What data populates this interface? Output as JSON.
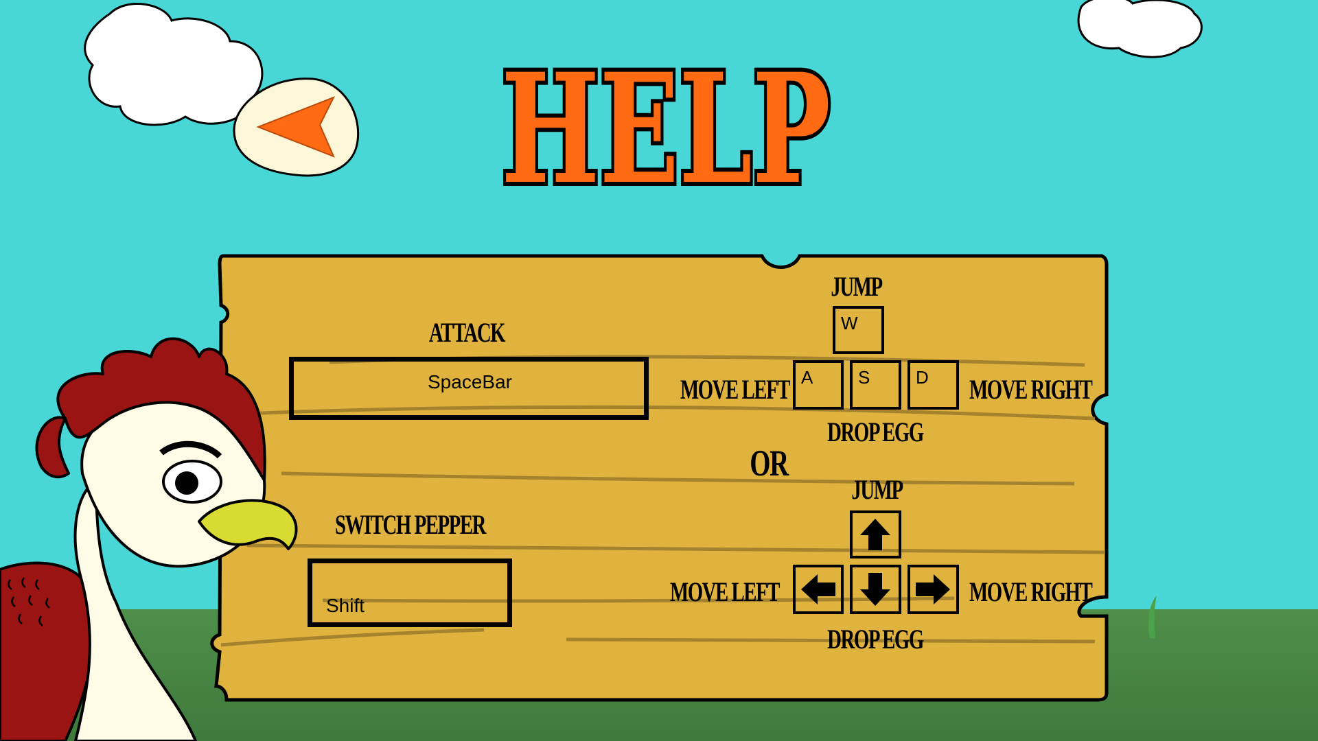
{
  "screen": {
    "title": "HELP",
    "back_icon": "left-arrow-egg-icon"
  },
  "controls": {
    "attack_label": "ATTACK",
    "attack_key": "SpaceBar",
    "switch_label": "SWITCH PEPPER",
    "switch_key": "Shift",
    "or_label": "OR",
    "wasd": {
      "jump_label": "JUMP",
      "move_left_label": "MOVE LEFT",
      "move_right_label": "MOVE RIGHT",
      "drop_label": "DROP EGG",
      "keys": {
        "up": "W",
        "left": "A",
        "down": "S",
        "right": "D"
      }
    },
    "arrows": {
      "jump_label": "JUMP",
      "move_left_label": "MOVE LEFT",
      "move_right_label": "MOVE RIGHT",
      "drop_label": "DROP EGG",
      "icons": {
        "up": "arrow-up-icon",
        "left": "arrow-left-icon",
        "down": "arrow-down-icon",
        "right": "arrow-right-icon"
      }
    }
  },
  "colors": {
    "sky": "#49d6d6",
    "title_orange": "#ff6a12",
    "board": "#e0b33f",
    "grass": "#4f8f49",
    "chicken_crest": "#9b1414",
    "beak": "#d8dc32"
  }
}
